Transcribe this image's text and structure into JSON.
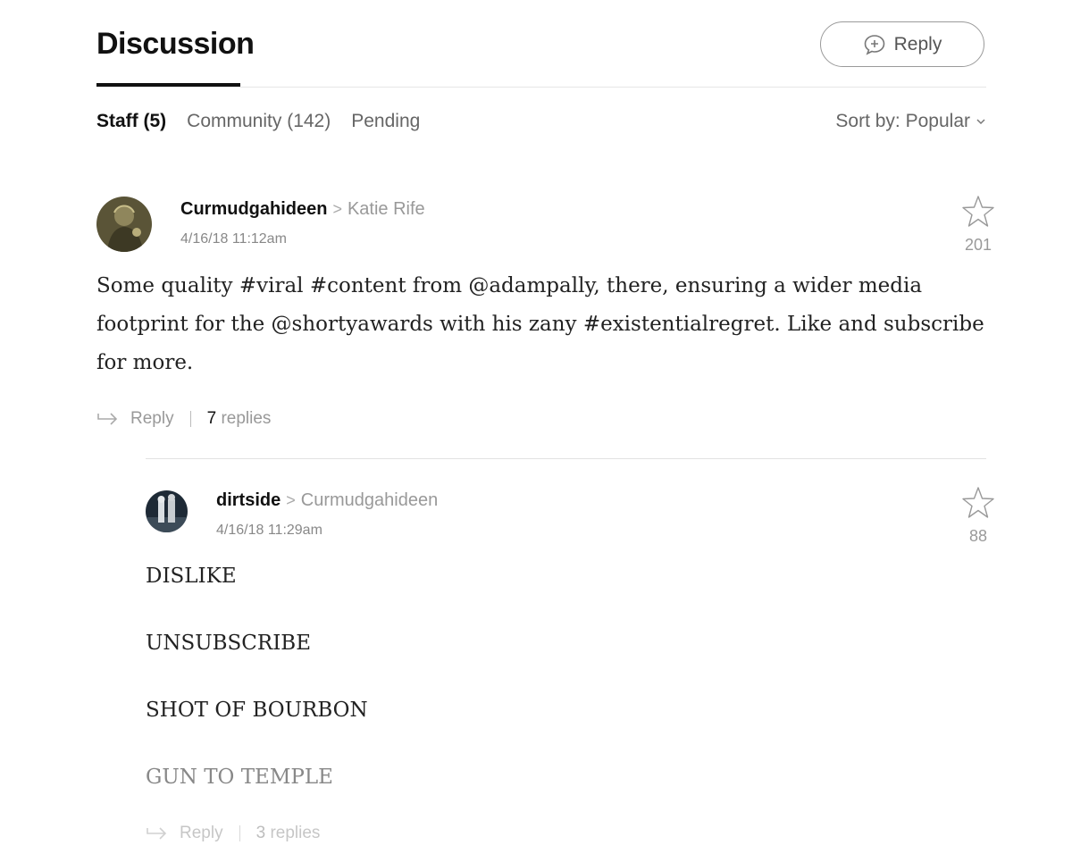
{
  "header": {
    "title": "Discussion",
    "reply_button_label": "Reply"
  },
  "tabs": [
    {
      "label": "Staff (5)",
      "active": true
    },
    {
      "label": "Community (142)",
      "active": false
    },
    {
      "label": "Pending",
      "active": false
    }
  ],
  "sort": {
    "label": "Sort by: Popular"
  },
  "comments": [
    {
      "author": "Curmudgahideen",
      "reply_to": "Katie Rife",
      "timestamp": "4/16/18 11:12am",
      "star_count": "201",
      "body": "Some quality #viral #content from @adampally, there, ensuring a wider media footprint for the @shortyawards with his zany #existentialregret. Like and subscribe for more.",
      "reply_label": "Reply",
      "replies_count": "7",
      "replies_label": "replies"
    },
    {
      "author": "dirtside",
      "reply_to": "Curmudgahideen",
      "timestamp": "4/16/18 11:29am",
      "star_count": "88",
      "lines": [
        "DISLIKE",
        "UNSUBSCRIBE",
        "SHOT OF BOURBON",
        "GUN TO TEMPLE"
      ],
      "reply_label": "Reply",
      "replies_count": "3",
      "replies_label": "replies"
    }
  ],
  "colors": {
    "text": "#222222",
    "muted": "#999999",
    "rule": "#e6e6e6"
  }
}
